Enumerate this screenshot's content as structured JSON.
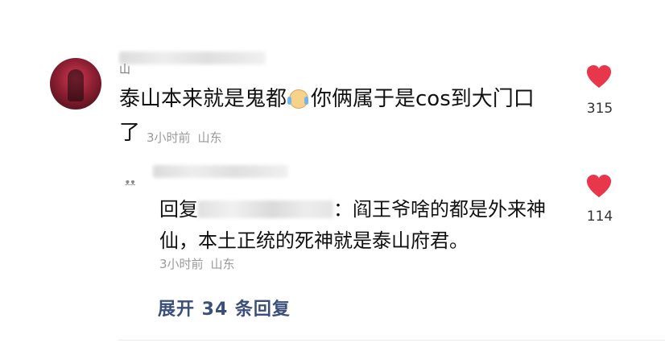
{
  "comment": {
    "avatar_icon": "user-avatar",
    "username_prefix": "山",
    "text_before_emoji": "泰山本来就是鬼都",
    "emoji_icon": "crying-laughing-face-icon",
    "text_after_emoji": "你俩属于是cos到大门口",
    "text_line2": "了",
    "time": "3小时前",
    "location": "山东",
    "likes": "315"
  },
  "reply": {
    "avatar_icon": "user-avatar",
    "prefix": "回复",
    "text": "：阎王爷啥的都是外来神仙，本土正统的死神就是泰山府君。",
    "time": "3小时前",
    "location": "山东",
    "likes": "114"
  },
  "expand_label": "展开 34 条回复",
  "colors": {
    "heart": "#e8364a",
    "link": "#3b4f7a",
    "meta": "#9a9a9a"
  }
}
